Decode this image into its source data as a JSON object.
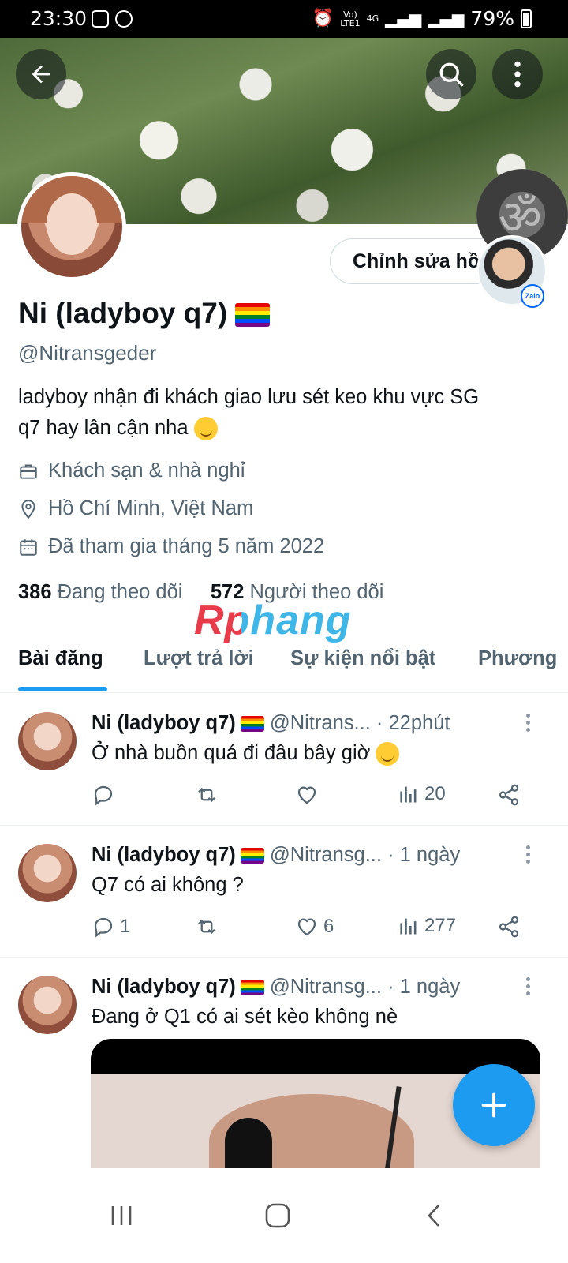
{
  "status_bar": {
    "time": "23:30",
    "network_top": "Vo)",
    "network_bottom": "LTE1",
    "network_type": "4G",
    "battery": "79%"
  },
  "header": {
    "back_icon": "arrow-left-icon",
    "search_icon": "search-icon",
    "more_icon": "more-vertical-icon",
    "edit_profile_label": "Chỉnh sửa hồ"
  },
  "profile": {
    "name": "Ni (ladyboy q7)",
    "handle": "@Nitransgeder",
    "bio_line1": "ladyboy nhận đi khách giao lưu sét keo khu vực SG",
    "bio_line2": "q7 hay lân cận nha",
    "category": "Khách sạn & nhà nghỉ",
    "location": "Hồ Chí Minh, Việt Nam",
    "joined": "Đã tham gia tháng 5 năm 2022",
    "following_count": "386",
    "following_label": "Đang theo dõi",
    "followers_count": "572",
    "followers_label": "Người theo dõi"
  },
  "watermark": "Rphang",
  "floating": {
    "zalo_label": "Zalo",
    "om_symbol": "ॐ"
  },
  "tabs": [
    "Bài đăng",
    "Lượt trả lời",
    "Sự kiện nổi bật",
    "Phương"
  ],
  "posts": [
    {
      "name": "Ni (ladyboy q7)",
      "handle": "@Nitrans...",
      "time": "· 22phút",
      "text": "Ở nhà buồn quá đi đâu bây giờ",
      "replies": "",
      "reposts": "",
      "likes": "",
      "views": "20"
    },
    {
      "name": "Ni (ladyboy q7)",
      "handle": "@Nitransg...",
      "time": "· 1 ngày",
      "text": "Q7 có ai không ?",
      "replies": "1",
      "reposts": "",
      "likes": "6",
      "views": "277"
    },
    {
      "name": "Ni (ladyboy q7)",
      "handle": "@Nitransg...",
      "time": "· 1 ngày",
      "text": "Đang ở Q1 có ai sét kèo không nè"
    }
  ],
  "colors": {
    "accent": "#1d9bf0",
    "text": "#0f1419",
    "muted": "#536471"
  }
}
